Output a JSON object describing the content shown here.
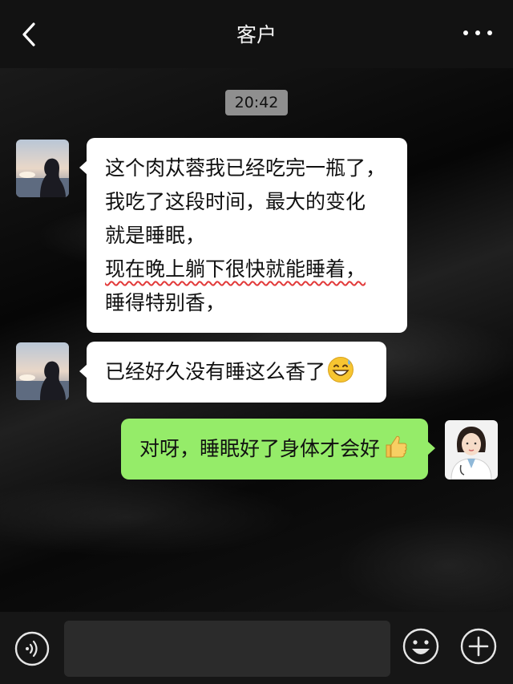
{
  "header": {
    "title": "客户",
    "back_icon": "chevron-left-icon",
    "more_icon": "more-dots-icon"
  },
  "chat": {
    "timestamp": "20:42",
    "messages": [
      {
        "side": "left",
        "lines": [
          "这个肉苁蓉我已经吃完一瓶了，",
          "我吃了这段时间，最大的变化",
          "就是睡眠，",
          "现在晚上躺下很快就能睡着，",
          "睡得特别香，"
        ]
      },
      {
        "side": "left",
        "text": "已经好久没有睡这么香了",
        "emoji": "grinning-sweat-emoji"
      },
      {
        "side": "right",
        "text": "对呀，睡眠好了身体才会好",
        "emoji": "thumbs-up-emoji"
      }
    ]
  },
  "composer": {
    "input_value": ""
  },
  "colors": {
    "sent_bubble": "#95ec69",
    "received_bubble": "#ffffff",
    "timestamp_bg": "#8f8f8f",
    "underline": "#e23a3a"
  }
}
